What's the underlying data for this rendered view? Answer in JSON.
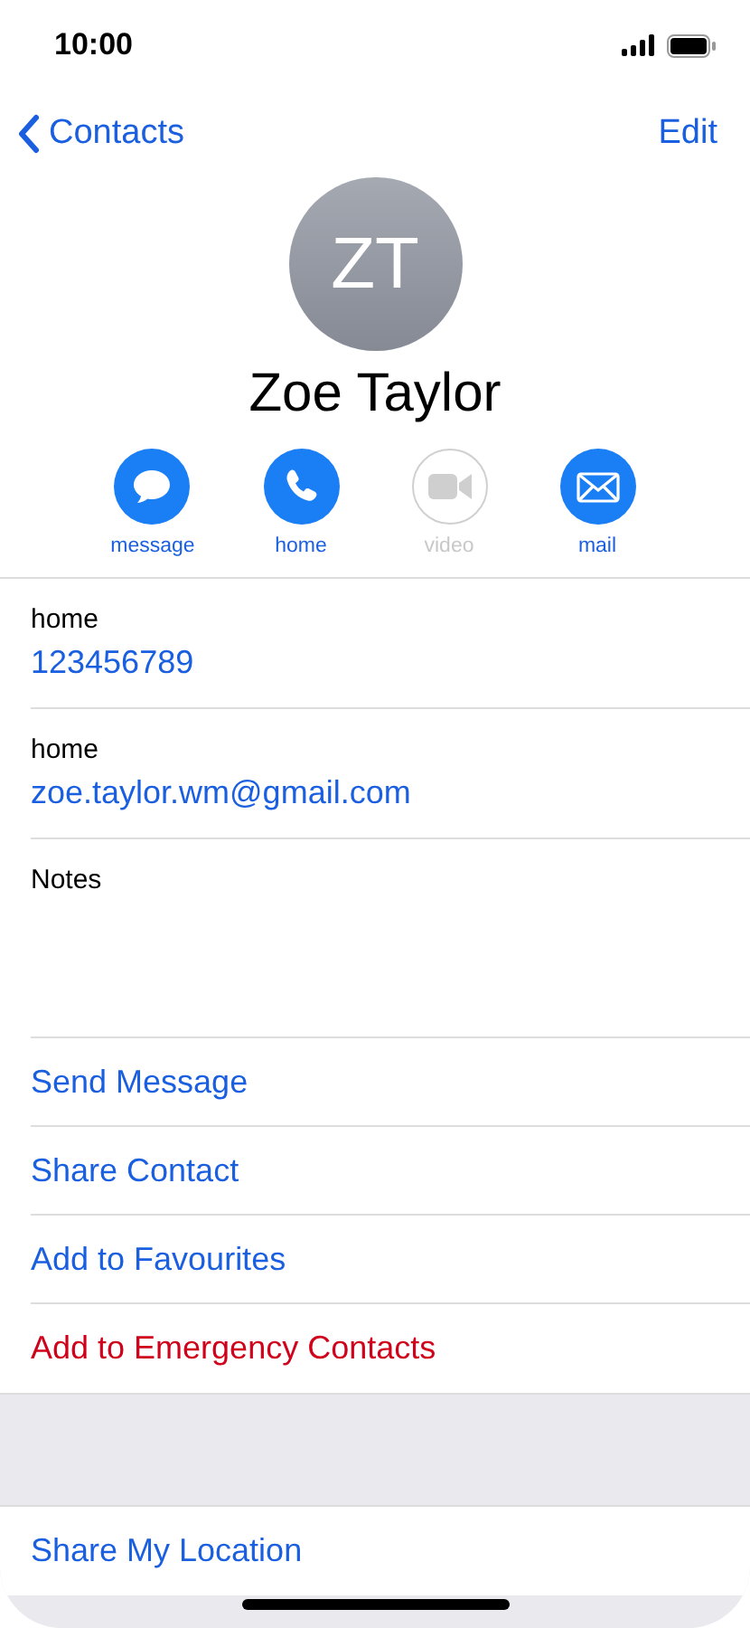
{
  "status_bar": {
    "time": "10:00"
  },
  "nav": {
    "back": "Contacts",
    "edit": "Edit"
  },
  "contact": {
    "initials": "ZT",
    "name": "Zoe Taylor"
  },
  "actions": [
    {
      "kind": "message",
      "label": "message",
      "disabled": false
    },
    {
      "kind": "phone",
      "label": "home",
      "disabled": false
    },
    {
      "kind": "video",
      "label": "video",
      "disabled": true
    },
    {
      "kind": "mail",
      "label": "mail",
      "disabled": false
    }
  ],
  "fields": [
    {
      "label": "home",
      "value": "123456789"
    },
    {
      "label": "home",
      "value": "zoe.taylor.wm@gmail.com"
    }
  ],
  "notes": {
    "label": "Notes"
  },
  "action_rows": [
    {
      "label": "Send Message",
      "destructive": false
    },
    {
      "label": "Share Contact",
      "destructive": false
    },
    {
      "label": "Add to Favourites",
      "destructive": false
    },
    {
      "label": "Add to Emergency Contacts",
      "destructive": true
    }
  ],
  "location_row": {
    "label": "Share My Location"
  }
}
